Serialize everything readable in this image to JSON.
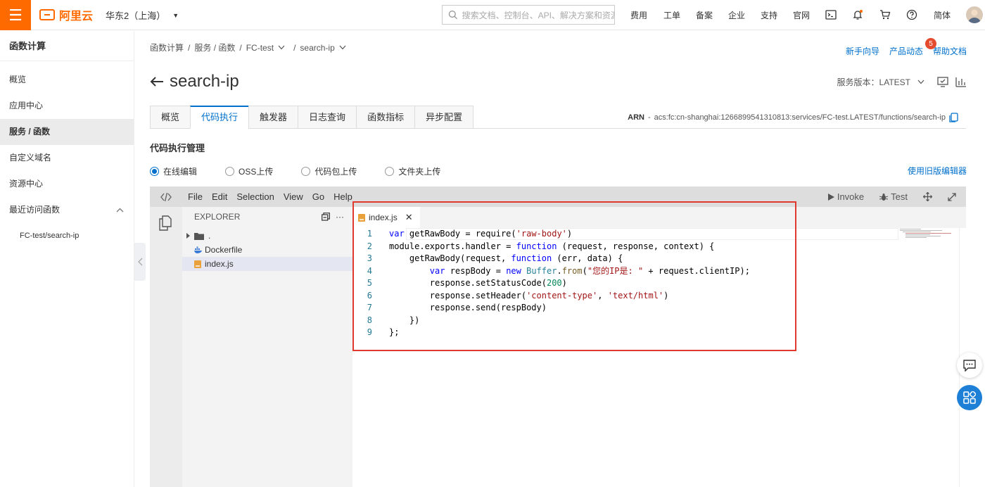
{
  "topbar": {
    "brand": "阿里云",
    "region": "华东2（上海）",
    "search_placeholder": "搜索文档、控制台、API、解决方案和资源",
    "nav": [
      "费用",
      "工单",
      "备案",
      "企业",
      "支持",
      "官网"
    ],
    "lang": "简体"
  },
  "sidebar": {
    "title": "函数计算",
    "items": [
      {
        "label": "概览"
      },
      {
        "label": "应用中心"
      },
      {
        "label": "服务 / 函数"
      },
      {
        "label": "自定义域名"
      },
      {
        "label": "资源中心"
      },
      {
        "label": "最近访问函数"
      }
    ],
    "recent": "FC-test/search-ip"
  },
  "breadcrumb": [
    "函数计算",
    "/",
    "服务 / 函数",
    "/",
    "FC-test",
    "/",
    "search-ip"
  ],
  "helpers": {
    "guide": "新手向导",
    "news": "产品动态",
    "news_badge": "5",
    "docs": "帮助文档"
  },
  "page": {
    "title": "search-ip",
    "version_label": "服务版本：LATEST",
    "arn_label": "ARN",
    "arn_value": "acs:fc:cn-shanghai:1266899541310813:services/FC-test.LATEST/functions/search-ip",
    "section_title": "代码执行管理",
    "old_editor": "使用旧版编辑器"
  },
  "tabs": [
    "概览",
    "代码执行",
    "触发器",
    "日志查询",
    "函数指标",
    "异步配置"
  ],
  "radios": [
    "在线编辑",
    "OSS上传",
    "代码包上传",
    "文件夹上传"
  ],
  "ide": {
    "menu": [
      "File",
      "Edit",
      "Selection",
      "View",
      "Go",
      "Help"
    ],
    "invoke": "Invoke",
    "test": "Test",
    "explorer_title": "EXPLORER",
    "tree": [
      ".",
      "Dockerfile",
      "index.js"
    ],
    "open_tab": "index.js",
    "line_numbers": [
      "1",
      "2",
      "3",
      "4",
      "5",
      "6",
      "7",
      "8",
      "9"
    ]
  },
  "colors": {
    "brand": "#ff6a00",
    "link": "#0070cc",
    "highlight": "#e03a2f"
  }
}
